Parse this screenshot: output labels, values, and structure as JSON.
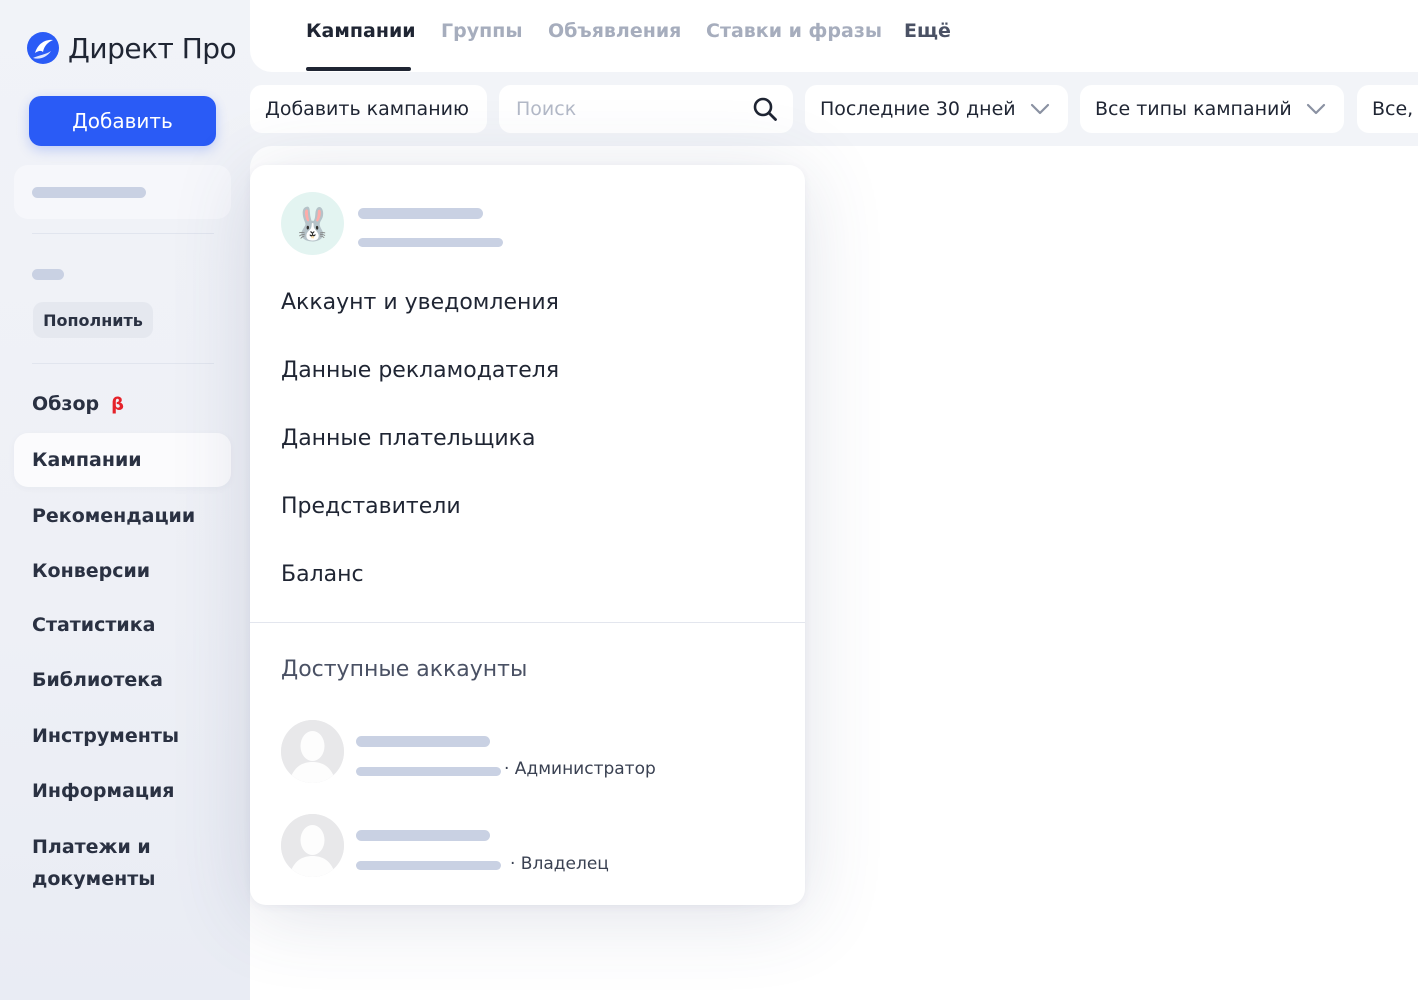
{
  "logo": {
    "text": "Директ Про"
  },
  "sidebar": {
    "add_button": "Добавить",
    "topup_button": "Пополнить",
    "beta_badge": "β",
    "items": [
      {
        "label": "Обзор"
      },
      {
        "label": "Кампании"
      },
      {
        "label": "Рекомендации"
      },
      {
        "label": "Конверсии"
      },
      {
        "label": "Статистика"
      },
      {
        "label": "Библиотека"
      },
      {
        "label": "Инструменты"
      },
      {
        "label": "Информация"
      },
      {
        "label": "Платежи и документы"
      }
    ]
  },
  "tabs": [
    {
      "label": "Кампании"
    },
    {
      "label": "Группы"
    },
    {
      "label": "Объявления"
    },
    {
      "label": "Ставки и фразы"
    },
    {
      "label": "Ещё"
    }
  ],
  "filters": {
    "add_campaign": "Добавить кампанию",
    "search_placeholder": "Поиск",
    "period": "Последние 30 дней",
    "campaign_types": "Все типы кампаний",
    "status": "Все,"
  },
  "account_menu": {
    "avatar_emoji": "🐰",
    "items": [
      {
        "label": "Аккаунт и уведомления"
      },
      {
        "label": "Данные рекламодателя"
      },
      {
        "label": "Данные плательщика"
      },
      {
        "label": "Представители"
      },
      {
        "label": "Баланс"
      }
    ],
    "accounts_title": "Доступные аккаунты",
    "accounts": [
      {
        "role": "· Администратор"
      },
      {
        "role": "· Владелец"
      }
    ]
  },
  "colors": {
    "accent": "#2a5bf6",
    "beta": "#e5222a",
    "skeleton": "#c9d1e3"
  }
}
